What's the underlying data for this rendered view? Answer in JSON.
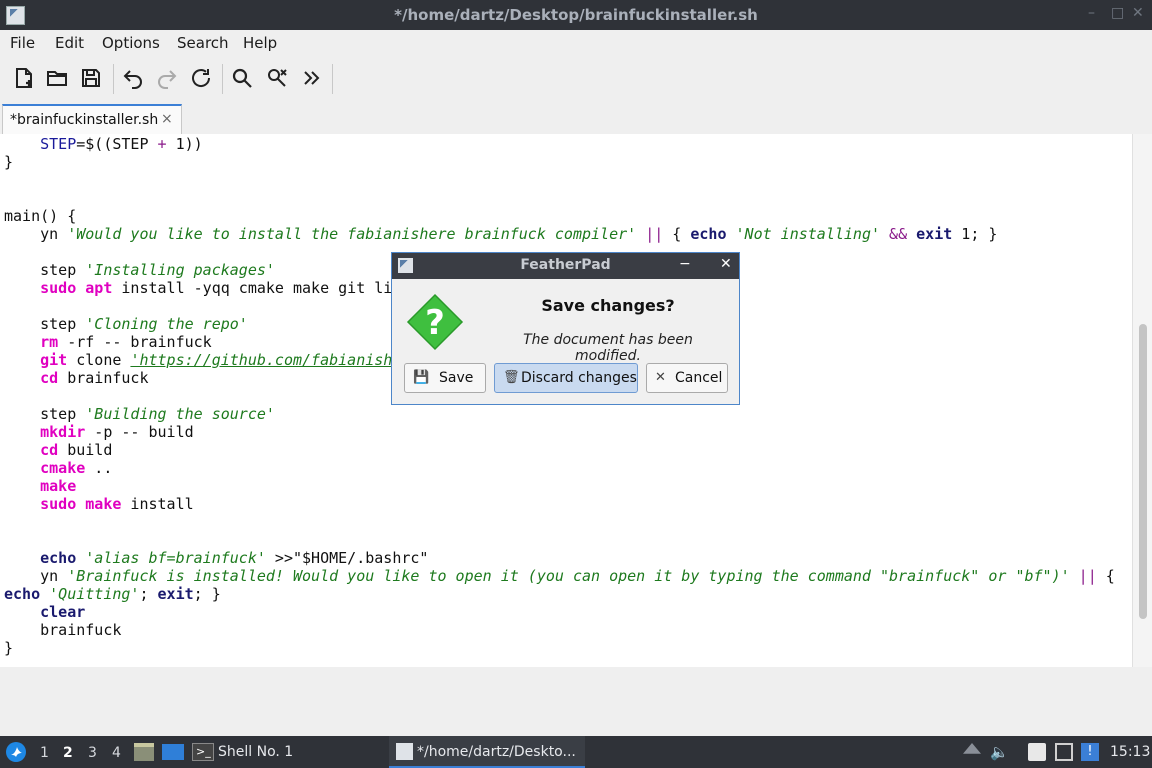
{
  "window": {
    "title": "*/home/dartz/Desktop/brainfuckinstaller.sh",
    "minimize_glyph": "–",
    "maximize_glyph": "□",
    "close_glyph": "✕"
  },
  "menu": {
    "file": "File",
    "edit": "Edit",
    "options": "Options",
    "search": "Search",
    "help": "Help"
  },
  "toolbar": {
    "icons": [
      "new-document-icon",
      "open-folder-icon",
      "save-icon",
      "undo-icon",
      "redo-icon",
      "reload-icon",
      "find-icon",
      "replace-icon",
      "more-icon"
    ]
  },
  "tab": {
    "label": "*brainfuckinstaller.sh",
    "close_glyph": "×"
  },
  "code_lines": [
    "    STEP=$((STEP + 1))",
    "}",
    "",
    "",
    "main() {",
    "    yn 'Would you like to install the fabianishere brainfuck compiler' || { echo 'Not installing' && exit 1; }",
    "",
    "    step 'Installing packages'",
    "    sudo apt install -yqq cmake make git li",
    "",
    "    step 'Cloning the repo'",
    "    rm -rf -- brainfuck",
    "    git clone 'https://github.com/fabianish",
    "    cd brainfuck",
    "",
    "    step 'Building the source'",
    "    mkdir -p -- build",
    "    cd build",
    "    cmake ..",
    "    make",
    "    sudo make install",
    "",
    "",
    "    echo 'alias bf=brainfuck' >>\"$HOME/.bashrc\"",
    "    yn 'Brainfuck is installed! Would you like to open it (you can open it by typing the command \"brainfuck\" or \"bf\")' || {",
    "echo 'Quitting'; exit; }",
    "    clear",
    "    brainfuck",
    "}"
  ],
  "dialog": {
    "title": "FeatherPad",
    "minimize_glyph": "−",
    "close_glyph": "✕",
    "heading": "Save changes?",
    "message": "The document has been modified.",
    "question_mark": "?",
    "buttons": {
      "save": "Save",
      "discard": "Discard changes",
      "cancel": "Cancel"
    }
  },
  "taskbar": {
    "workspaces": [
      "1",
      "2",
      "3",
      "4"
    ],
    "active_workspace": "2",
    "shell_task": "Shell No. 1",
    "editor_task": "*/home/dartz/Deskto...",
    "clock": "15:13"
  },
  "colors": {
    "accent": "#3b7fd6",
    "keyword_magenta": "#e000c0",
    "string_green": "#1e7a1e",
    "dialog_icon_green": "#3fbf3f"
  }
}
